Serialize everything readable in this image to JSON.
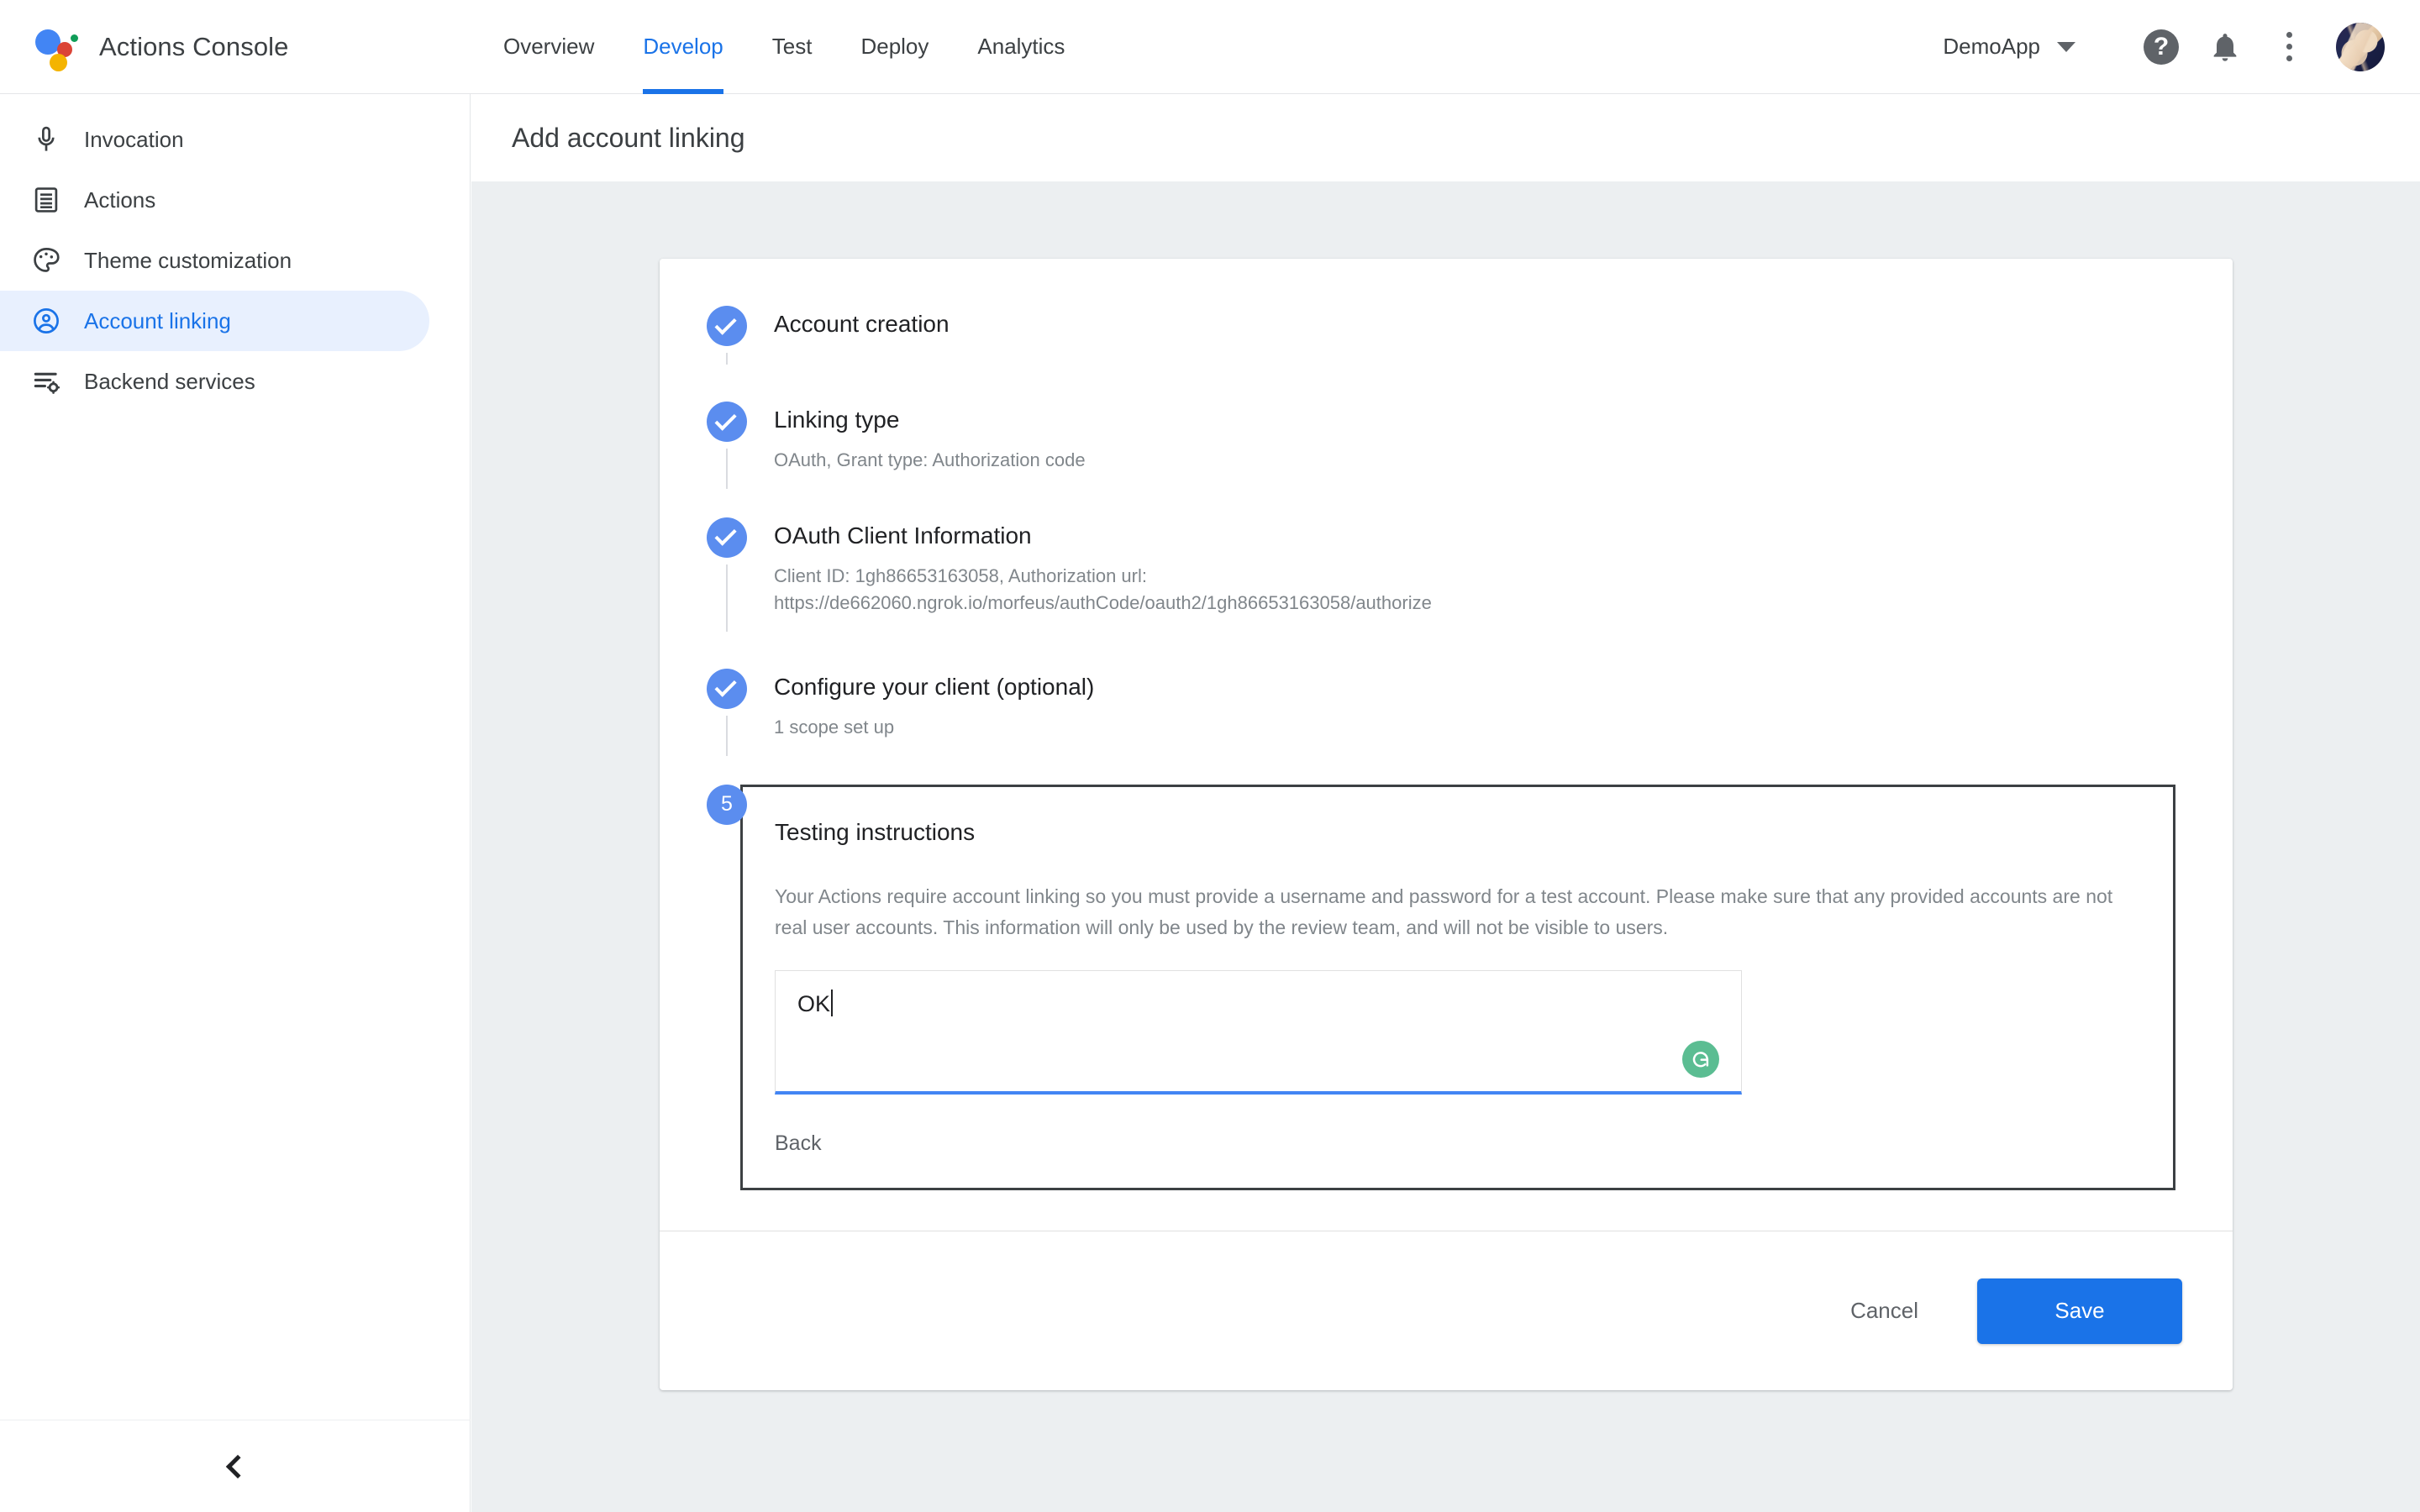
{
  "app": {
    "brand_title": "Actions Console",
    "logo_icon": "google-assistant-logo"
  },
  "topnav": {
    "items": [
      {
        "label": "Overview",
        "active": false
      },
      {
        "label": "Develop",
        "active": true
      },
      {
        "label": "Test",
        "active": false
      },
      {
        "label": "Deploy",
        "active": false
      },
      {
        "label": "Analytics",
        "active": false
      }
    ],
    "project_selector": "DemoApp",
    "help_icon": "help-icon",
    "notifications_icon": "bell-icon",
    "more_icon": "kebab-menu-icon",
    "avatar_icon": "user-avatar"
  },
  "sidebar": {
    "items": [
      {
        "label": "Invocation",
        "icon": "microphone-icon",
        "active": false
      },
      {
        "label": "Actions",
        "icon": "document-list-icon",
        "active": false
      },
      {
        "label": "Theme customization",
        "icon": "palette-icon",
        "active": false
      },
      {
        "label": "Account linking",
        "icon": "account-circle-icon",
        "active": true
      },
      {
        "label": "Backend services",
        "icon": "settings-list-icon",
        "active": false
      }
    ],
    "collapse_icon": "chevron-left-icon"
  },
  "page": {
    "title": "Add account linking"
  },
  "stepper": {
    "steps": [
      {
        "number": "1",
        "state": "complete",
        "title": "Account creation",
        "subtitle": ""
      },
      {
        "number": "2",
        "state": "complete",
        "title": "Linking type",
        "subtitle": "OAuth, Grant type: Authorization code"
      },
      {
        "number": "3",
        "state": "complete",
        "title": "OAuth Client Information",
        "subtitle": "Client ID: 1gh86653163058, Authorization url:",
        "subtitle_line2": "https://de662060.ngrok.io/morfeus/authCode/oauth2/1gh86653163058/authorize"
      },
      {
        "number": "4",
        "state": "complete",
        "title": "Configure your client (optional)",
        "subtitle": "1 scope set up"
      },
      {
        "number": "5",
        "state": "active",
        "title": "Testing instructions",
        "description": "Your Actions require account linking so you must provide a username and password for a test account. Please make sure that any provided accounts are not real user accounts. This information will only be used by the review team, and will not be visible to users.",
        "textarea_value": "OK",
        "textarea_placeholder": "",
        "textarea_addon_icon": "grammarly-icon",
        "back_label": "Back"
      }
    ]
  },
  "footer": {
    "cancel_label": "Cancel",
    "save_label": "Save"
  },
  "colors": {
    "accent_blue": "#1a73e8",
    "step_blue": "#5b8def",
    "sidebar_active_bg": "#e8f0fe",
    "content_bg": "#eceff1",
    "grammarly_green": "#5bbd92",
    "focus_border": "#3c4043"
  }
}
